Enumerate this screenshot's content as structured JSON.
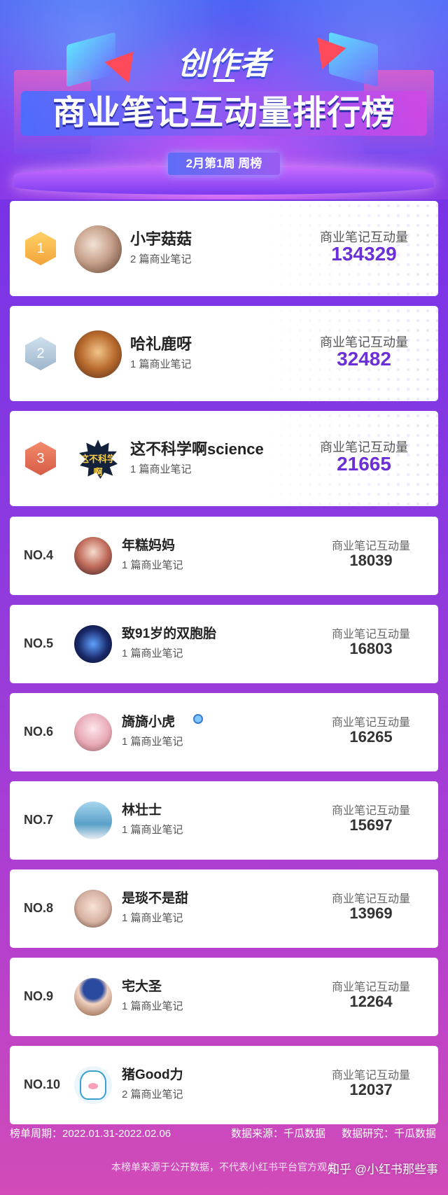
{
  "header": {
    "brand": "创作者",
    "title": "商业笔记互动量排行榜",
    "week_badge": "2月第1周 周榜"
  },
  "metric_label": "商业笔记互动量",
  "ranks": [
    {
      "rank": "1",
      "name": "小宇菇菇",
      "notes": "2 篇商业笔记",
      "value": "134329",
      "avatar": "avatar-photo"
    },
    {
      "rank": "2",
      "name": "哈礼鹿呀",
      "notes": "1 篇商业笔记",
      "value": "32482",
      "avatar": "dog-photo"
    },
    {
      "rank": "3",
      "name": "这不科学啊science",
      "notes": "1 篇商业笔记",
      "value": "21665",
      "avatar": "starburst-logo",
      "avatar_text": "这不科学啊"
    },
    {
      "rank": "NO.4",
      "name": "年糕妈妈",
      "notes": "1 篇商业笔记",
      "value": "18039"
    },
    {
      "rank": "NO.5",
      "name": "致91岁的双胞胎",
      "notes": "1 篇商业笔记",
      "value": "16803"
    },
    {
      "rank": "NO.6",
      "name": "旖旖小虎",
      "notes": "1 篇商业笔记",
      "value": "16265"
    },
    {
      "rank": "NO.7",
      "name": "林壮士",
      "notes": "1 篇商业笔记",
      "value": "15697"
    },
    {
      "rank": "NO.8",
      "name": "是琰不是甜",
      "notes": "1 篇商业笔记",
      "value": "13969"
    },
    {
      "rank": "NO.9",
      "name": "宅大圣",
      "notes": "1 篇商业笔记",
      "value": "12264"
    },
    {
      "rank": "NO.10",
      "name": "猪Good力",
      "notes": "2 篇商业笔记",
      "value": "12037"
    }
  ],
  "footer": {
    "period": "榜单周期：2022.01.31-2022.02.06",
    "source": "数据来源：千瓜数据",
    "research": "数据研究：千瓜数据",
    "disclaimer": "本榜单来源于公开数据，不代表小红书平台官方观点",
    "watermark": "知乎 @小红书那些事"
  },
  "colors": {
    "accent_purple": "#6a2fd6",
    "gold": "#f2a33a",
    "silver": "#9db6cc",
    "bronze": "#d65c47"
  }
}
